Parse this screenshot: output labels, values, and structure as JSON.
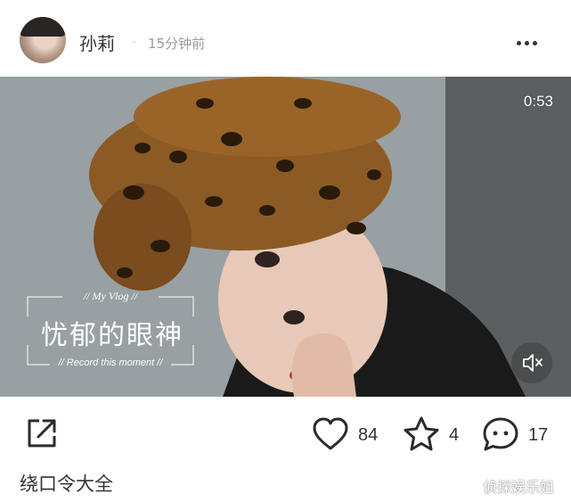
{
  "post": {
    "username": "孙莉",
    "separator": "·",
    "time_ago": "15分钟前",
    "caption": "绕口令大全"
  },
  "video": {
    "duration": "0:53",
    "overlay": {
      "top_text": "// My Vlog //",
      "main_text": "忧郁的眼神",
      "bottom_text": "// Record this moment //"
    },
    "muted": true
  },
  "actions": {
    "likes": "84",
    "favorites": "4",
    "comments": "17"
  },
  "icons": {
    "more": "more-dots-icon",
    "share": "share-icon",
    "like": "heart-icon",
    "favorite": "star-icon",
    "comment": "comment-icon",
    "mute": "speaker-muted-icon"
  },
  "watermark": "侦探娱乐姐"
}
